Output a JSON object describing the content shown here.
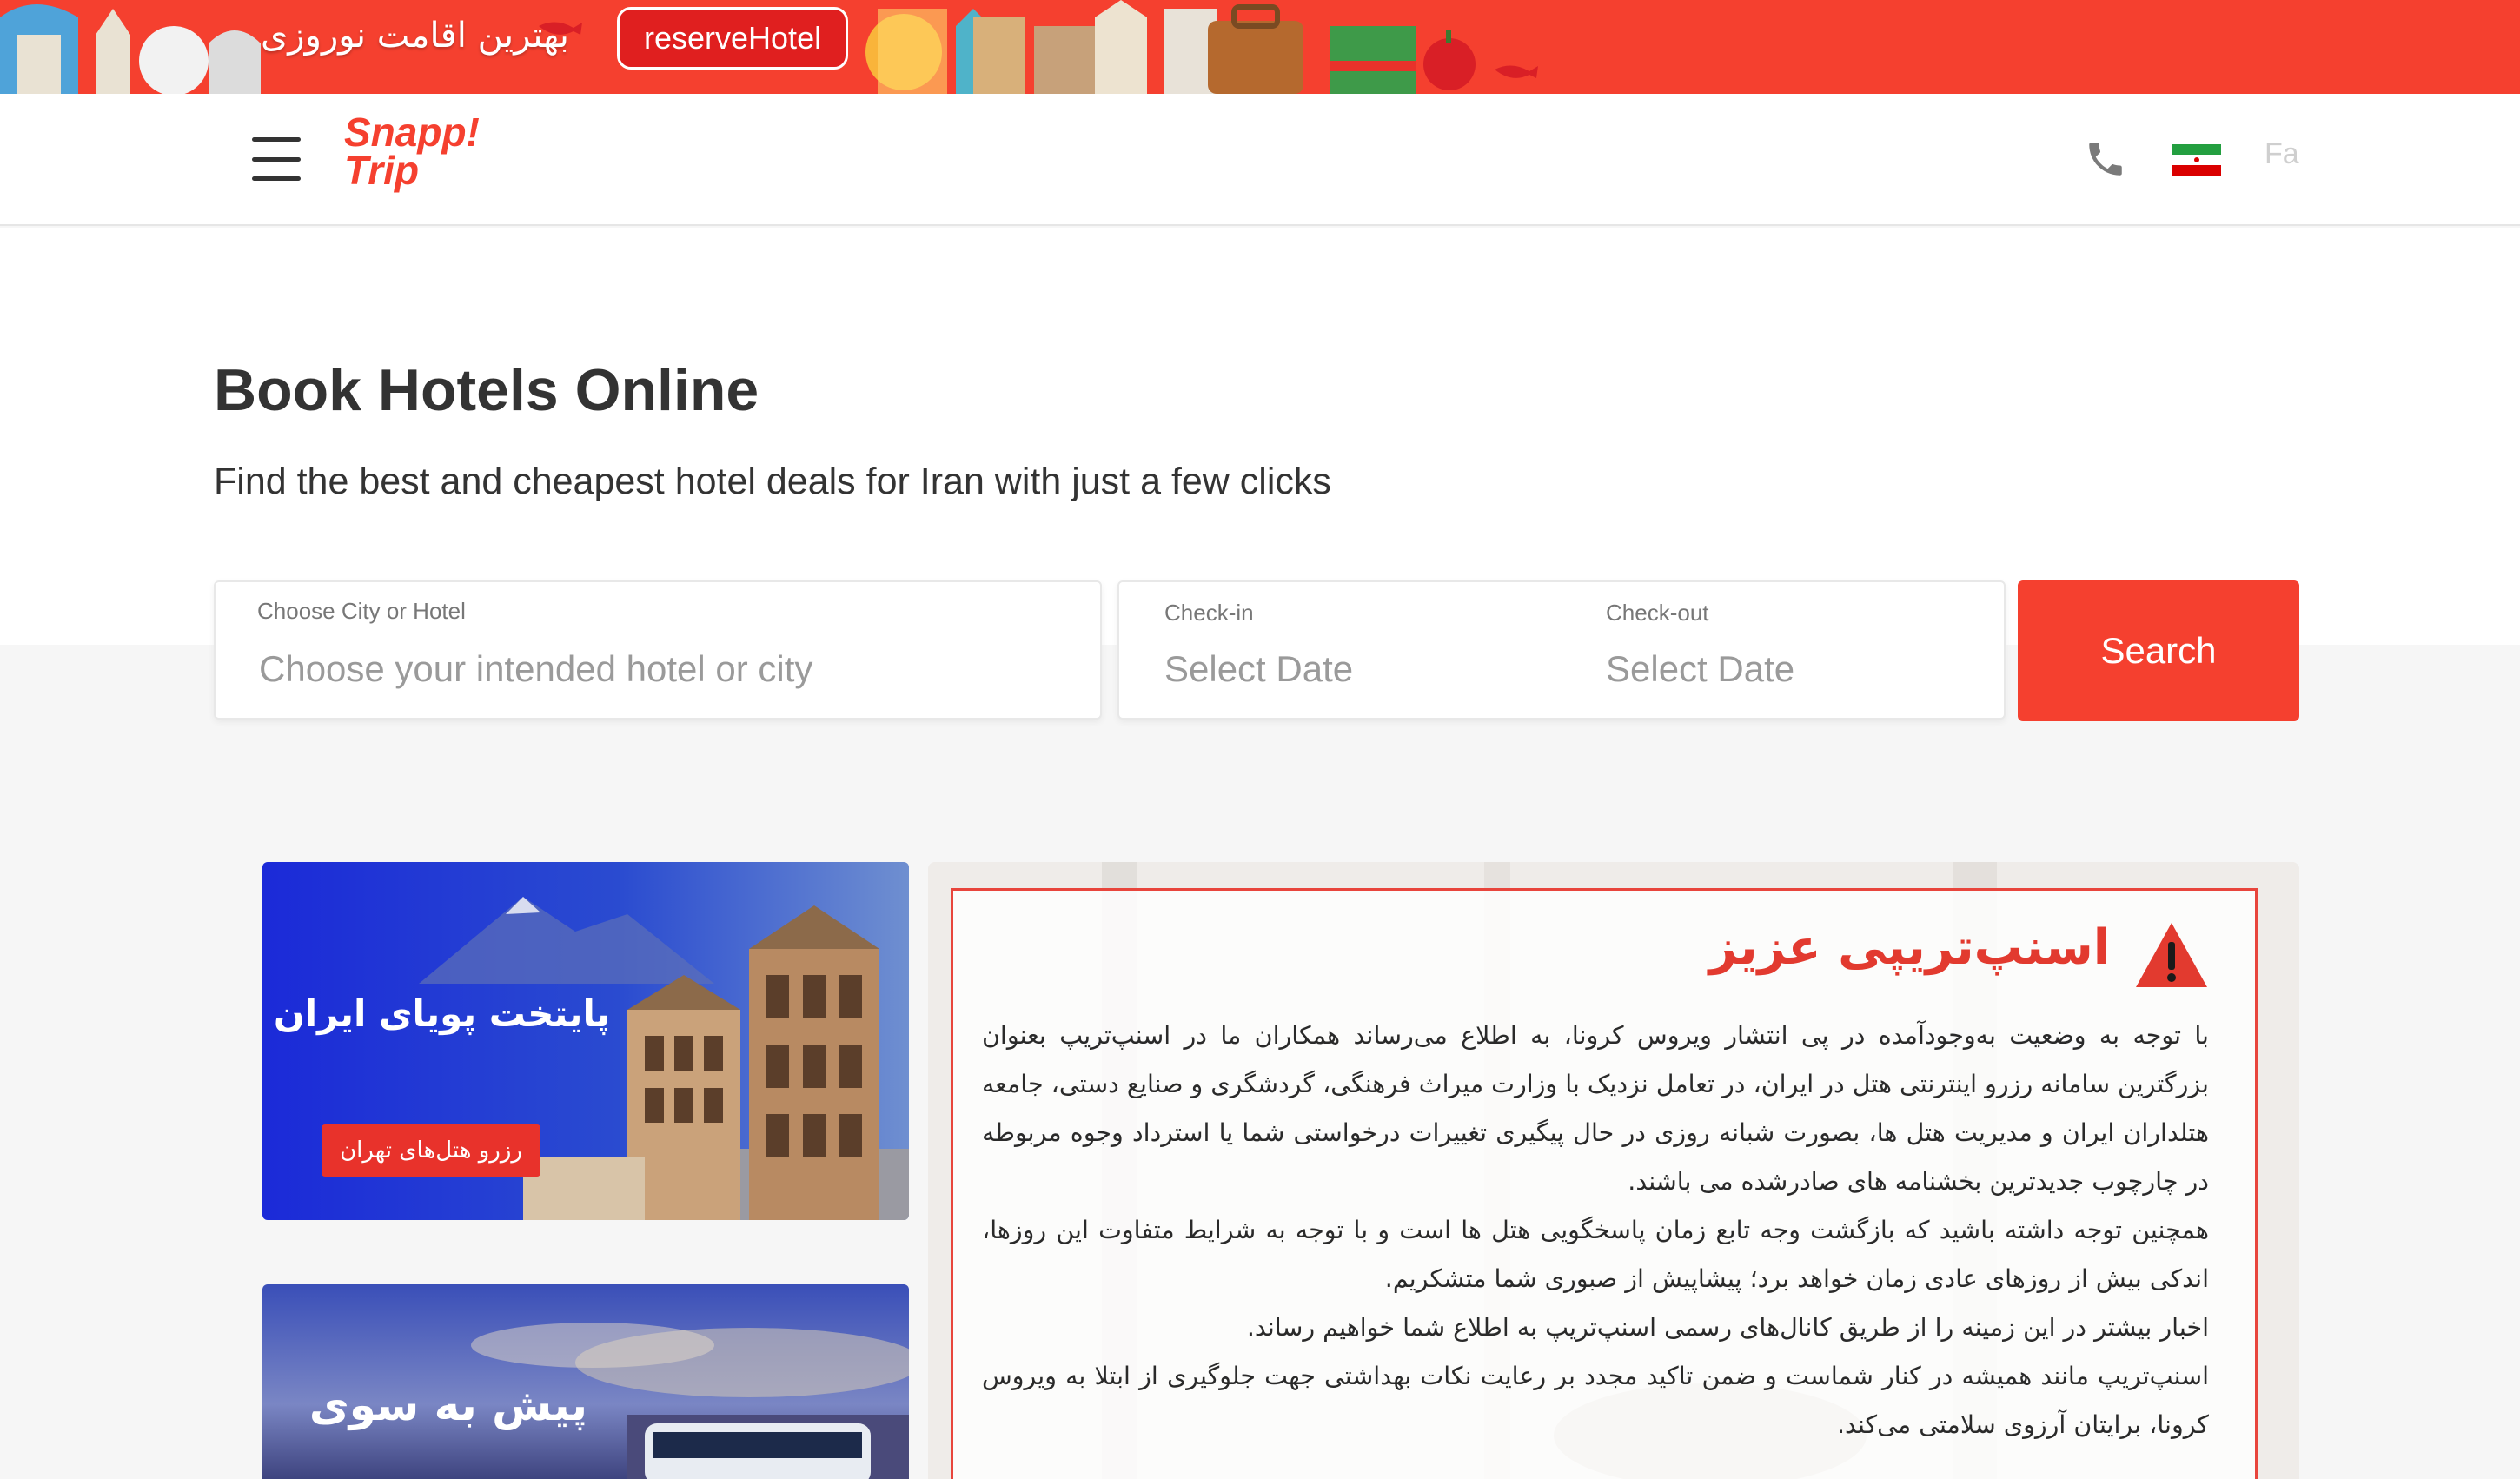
{
  "promo": {
    "text": "بهترین اقامت نوروزی",
    "pill": "reserveHotel"
  },
  "header": {
    "logo_line1": "Snapp!",
    "logo_line2": "Trip",
    "language": "Fa",
    "menu_icon": "hamburger-menu-icon",
    "phone_icon": "phone-icon",
    "flag_icon": "iran-flag-icon"
  },
  "hero": {
    "title": "Book Hotels Online",
    "subtitle": "Find the best and cheapest hotel deals for Iran with just a few clicks"
  },
  "search": {
    "city_label": "Choose City or Hotel",
    "city_placeholder": "Choose your intended hotel or city",
    "checkin_label": "Check-in",
    "checkin_value": "Select Date",
    "checkout_label": "Check-out",
    "checkout_value": "Select Date",
    "button": "Search"
  },
  "banners": [
    {
      "title": "پایتخت پویای ایران",
      "button": "رزرو هتل‌های تهران"
    },
    {
      "title": "پیش به سوی"
    }
  ],
  "notice": {
    "title": "اسنپ‌تریپی عزیز",
    "icon": "warning-icon",
    "paragraphs": [
      "با توجه به وضعیت به‌وجودآمده در پی انتشار ویروس کرونا، به اطلاع می‌رساند همکاران ما در اسنپ‌تریپ بعنوان بزرگترین سامانه رزرو اینترنتی هتل در ایران، در تعامل نزدیک با وزارت میراث فرهنگی، گردشگری و صنایع دستی، جامعه هتلداران ایران و مدیریت هتل ها، بصورت شبانه روزی در حال پیگیری تغییرات درخواستی شما یا استرداد وجوه مربوطه در چارچوب جدیدترین بخشنامه های صادرشده می باشند.",
      "همچنین توجه داشته باشید که بازگشت وجه تابع زمان پاسخگویی هتل ها است و با توجه به شرایط متفاوت این روزها، اندکی بیش از روزهای عادی زمان خواهد برد؛ پیشاپیش از صبوری شما متشکریم.",
      "اخبار بیشتر در این زمینه را از طریق کانال‌های رسمی اسنپ‌تریپ به اطلاع شما خواهیم رساند.",
      "اسنپ‌تریپ مانند همیشه در کنار شماست و ضمن تاکید مجدد بر رعایت نکات بهداشتی جهت جلوگیری از ابتلا به ویروس کرونا، برایتان آرزوی سلامتی می‌کند."
    ]
  },
  "colors": {
    "brand": "#f5402f",
    "notice_border": "#e8453c"
  }
}
